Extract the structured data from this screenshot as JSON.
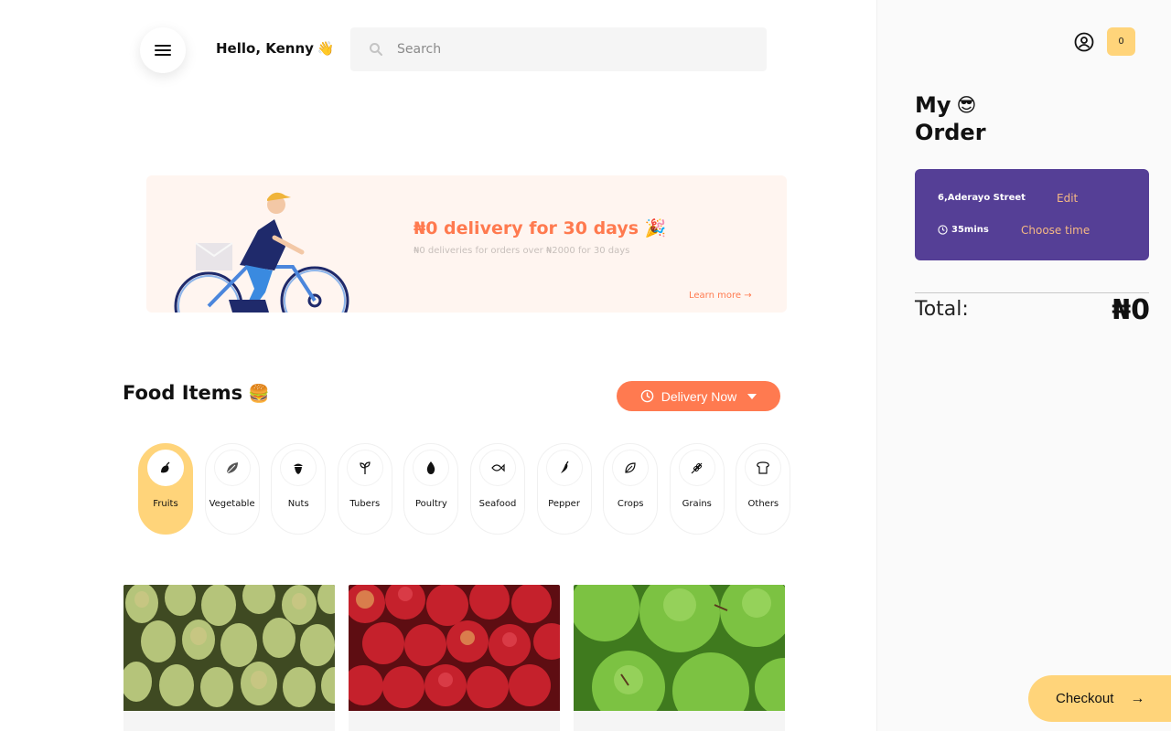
{
  "header": {
    "greeting": "Hello, Kenny",
    "greeting_emoji": "👋",
    "search_placeholder": "Search"
  },
  "banner": {
    "title": "₦0 delivery for 30 days 🎉",
    "subtitle": "₦0 deliveries for orders over ₦2000 for 30 days",
    "link": "Learn more →"
  },
  "food_section": {
    "title": "Food Items",
    "title_emoji": "🍔",
    "delivery_button": "Delivery Now"
  },
  "categories": [
    {
      "label": "Fruits",
      "icon": "fruit-icon",
      "active": true
    },
    {
      "label": "Vegetable",
      "icon": "vegetable-icon",
      "active": false
    },
    {
      "label": "Nuts",
      "icon": "nut-icon",
      "active": false
    },
    {
      "label": "Tubers",
      "icon": "sprout-icon",
      "active": false
    },
    {
      "label": "Poultry",
      "icon": "egg-icon",
      "active": false
    },
    {
      "label": "Seafood",
      "icon": "fish-icon",
      "active": false
    },
    {
      "label": "Pepper",
      "icon": "pepper-icon",
      "active": false
    },
    {
      "label": "Crops",
      "icon": "leaf-icon",
      "active": false
    },
    {
      "label": "Grains",
      "icon": "wheat-icon",
      "active": false
    },
    {
      "label": "Others",
      "icon": "bread-icon",
      "active": false
    }
  ],
  "products": [
    {
      "image": "pears-image"
    },
    {
      "image": "red-apples-image"
    },
    {
      "image": "green-apples-image"
    }
  ],
  "order": {
    "cart_count": "0",
    "title_line1": "My",
    "title_emoji": "😎",
    "title_line2": "Order",
    "address": "6,Aderayo Street",
    "edit_label": "Edit",
    "time": "35mins",
    "choose_time_label": "Choose time",
    "total_label": "Total:",
    "total_value": "₦0",
    "checkout_label": "Checkout",
    "checkout_arrow": "→"
  },
  "colors": {
    "accent_orange": "#ff7a50",
    "accent_yellow": "#ffd47a",
    "card_purple": "#553f96",
    "banner_bg": "#fff5f0"
  }
}
